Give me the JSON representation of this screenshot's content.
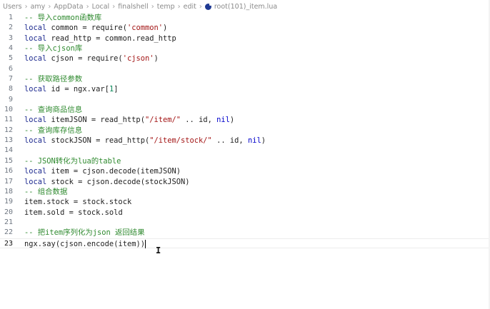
{
  "breadcrumb": {
    "items": [
      "Users",
      "amy",
      "AppData",
      "Local",
      "finalshell",
      "temp",
      "edit"
    ],
    "file_label": "root(101)_item.lua",
    "file_icon": "lua-file-icon"
  },
  "editor": {
    "current_line": 23,
    "lines": [
      {
        "n": "1",
        "text": "-- 导入common函数库"
      },
      {
        "n": "2",
        "text": "local common = require('common')"
      },
      {
        "n": "3",
        "text": "local read_http = common.read_http"
      },
      {
        "n": "4",
        "text": "-- 导入cjson库"
      },
      {
        "n": "5",
        "text": "local cjson = require('cjson')"
      },
      {
        "n": "6",
        "text": ""
      },
      {
        "n": "7",
        "text": "-- 获取路径参数"
      },
      {
        "n": "8",
        "text": "local id = ngx.var[1]"
      },
      {
        "n": "9",
        "text": ""
      },
      {
        "n": "10",
        "text": "-- 查询商品信息"
      },
      {
        "n": "11",
        "text": "local itemJSON = read_http(\"/item/\" .. id, nil)"
      },
      {
        "n": "12",
        "text": "-- 查询库存信息"
      },
      {
        "n": "13",
        "text": "local stockJSON = read_http(\"/item/stock/\" .. id, nil)"
      },
      {
        "n": "14",
        "text": ""
      },
      {
        "n": "15",
        "text": "-- JSON转化为lua的table"
      },
      {
        "n": "16",
        "text": "local item = cjson.decode(itemJSON)"
      },
      {
        "n": "17",
        "text": "local stock = cjson.decode(stockJSON)"
      },
      {
        "n": "18",
        "text": "-- 组合数据"
      },
      {
        "n": "19",
        "text": "item.stock = stock.stock"
      },
      {
        "n": "20",
        "text": "item.sold = stock.sold"
      },
      {
        "n": "21",
        "text": ""
      },
      {
        "n": "22",
        "text": "-- 把item序列化为json 返回结果"
      },
      {
        "n": "23",
        "text": "ngx.say(cjson.encode(item))"
      }
    ]
  },
  "colors": {
    "keyword": "#1d2a8f",
    "comment": "#2f8a2f",
    "string": "#a31515",
    "number": "#098658"
  }
}
